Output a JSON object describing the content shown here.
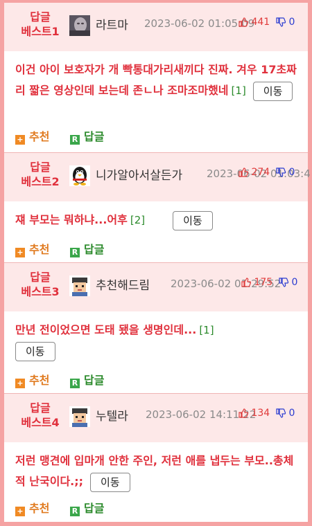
{
  "common": {
    "move_label": "이동",
    "recommend_label": "추천",
    "reply_label": "답글",
    "plus_glyph": "+",
    "r_glyph": "R"
  },
  "items": [
    {
      "rank_line1": "답글",
      "rank_line2": "베스트1",
      "nickname": "라트마",
      "avatar_icon": "photo-avatar-icon",
      "date": "2023-06-02 01:05:09",
      "up_count": "441",
      "down_count": "0",
      "content": "이건 아이 보호자가 개 빡통대가리새끼다 진짜. 겨우 17초짜리 짧은 영상인데 보는데 존ㄴ나 조마조마했네",
      "comment_count": "[1]"
    },
    {
      "rank_line1": "답글",
      "rank_line2": "베스트2",
      "nickname": "니가알아서살든가",
      "avatar_icon": "penguin-avatar-icon",
      "date": "2023-06-02 01:03:4",
      "up_count": "274",
      "down_count": "0",
      "content": "쟤 부모는 뭐하냐...어후",
      "comment_count": "[2]"
    },
    {
      "rank_line1": "답글",
      "rank_line2": "베스트3",
      "nickname": "추천해드림",
      "avatar_icon": "pixel-face-avatar-icon",
      "date": "2023-06-02 01:29:52",
      "up_count": "175",
      "down_count": "0",
      "content": "만년 전이었으면 도태 됐을 생명인데...",
      "comment_count": "[1]"
    },
    {
      "rank_line1": "답글",
      "rank_line2": "베스트4",
      "nickname": "누텔라",
      "avatar_icon": "pixel-face-avatar-icon",
      "date": "2023-06-02 14:11:22",
      "up_count": "134",
      "down_count": "0",
      "content": "저런 맹견에 입마개 안한 주인, 저런 애를 냅두는 부모..총체적 난국이다.;;",
      "comment_count": ""
    }
  ]
}
